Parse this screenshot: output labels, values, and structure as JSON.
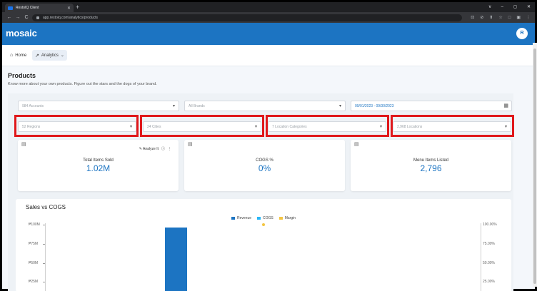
{
  "browser": {
    "tab_title": "RestoIQ Client",
    "new_tab": "+",
    "url": "app.restoiq.com/analytics/products",
    "nav_back": "←",
    "nav_forward": "→",
    "nav_reload": "C",
    "window_controls": [
      "v",
      "–",
      "◻",
      "✕"
    ],
    "toolbar_icons": [
      "⊡",
      "⊘",
      "⬆",
      "☆",
      "□",
      "▣",
      "⋮"
    ]
  },
  "app": {
    "logo": "mosaic",
    "avatar_initial": "R",
    "brand_color": "#1c74c2"
  },
  "nav": {
    "home_label": "Home",
    "analytics_label": "Analytics",
    "home_icon": "home-icon",
    "analytics_icon": "trend-icon"
  },
  "page": {
    "title": "Products",
    "subtitle": "Know more about your own products. Figure out the stars and the dogs of your brand."
  },
  "filters": {
    "accounts_placeholder": "984 Accounts",
    "brands_placeholder": "All Brands",
    "date_range": "09/01/2023 - 09/30/2023",
    "regions_placeholder": "52 Regions",
    "cities_placeholder": "24 Cities",
    "location_categories_placeholder": "7 Location Categories",
    "locations_placeholder": "2,968 Locations",
    "highlight_color": "#e0181b"
  },
  "kpis": [
    {
      "label": "Total Items Sold",
      "value": "1.02M"
    },
    {
      "label": "COGS %",
      "value": "0%"
    },
    {
      "label": "Menu Items Listed",
      "value": "2,796"
    }
  ],
  "analyze_label": "Analyze It",
  "chart": {
    "title": "Sales vs COGS",
    "legend": [
      {
        "name": "Revenue",
        "color": "#1c74c2"
      },
      {
        "name": "COGS",
        "color": "#29b6f6"
      },
      {
        "name": "Margin",
        "color": "#f4c542"
      }
    ],
    "left_ticks": [
      "₱100M",
      "₱75M",
      "₱50M",
      "₱25M"
    ],
    "right_ticks": [
      "100.00%",
      "75.00%",
      "50.00%",
      "25.00%"
    ]
  },
  "chart_data": {
    "type": "bar",
    "title": "Sales vs COGS",
    "series": [
      {
        "name": "Revenue",
        "values": [
          96
        ]
      },
      {
        "name": "COGS",
        "values": [
          0
        ]
      },
      {
        "name": "Margin",
        "values": [
          100
        ]
      }
    ],
    "left_axis_ticks": [
      "₱100M",
      "₱75M",
      "₱50M",
      "₱25M"
    ],
    "right_axis_ticks": [
      "100.00%",
      "75.00%",
      "50.00%",
      "25.00%"
    ],
    "ylim_left": [
      0,
      100
    ],
    "ylim_right": [
      0,
      100
    ]
  }
}
